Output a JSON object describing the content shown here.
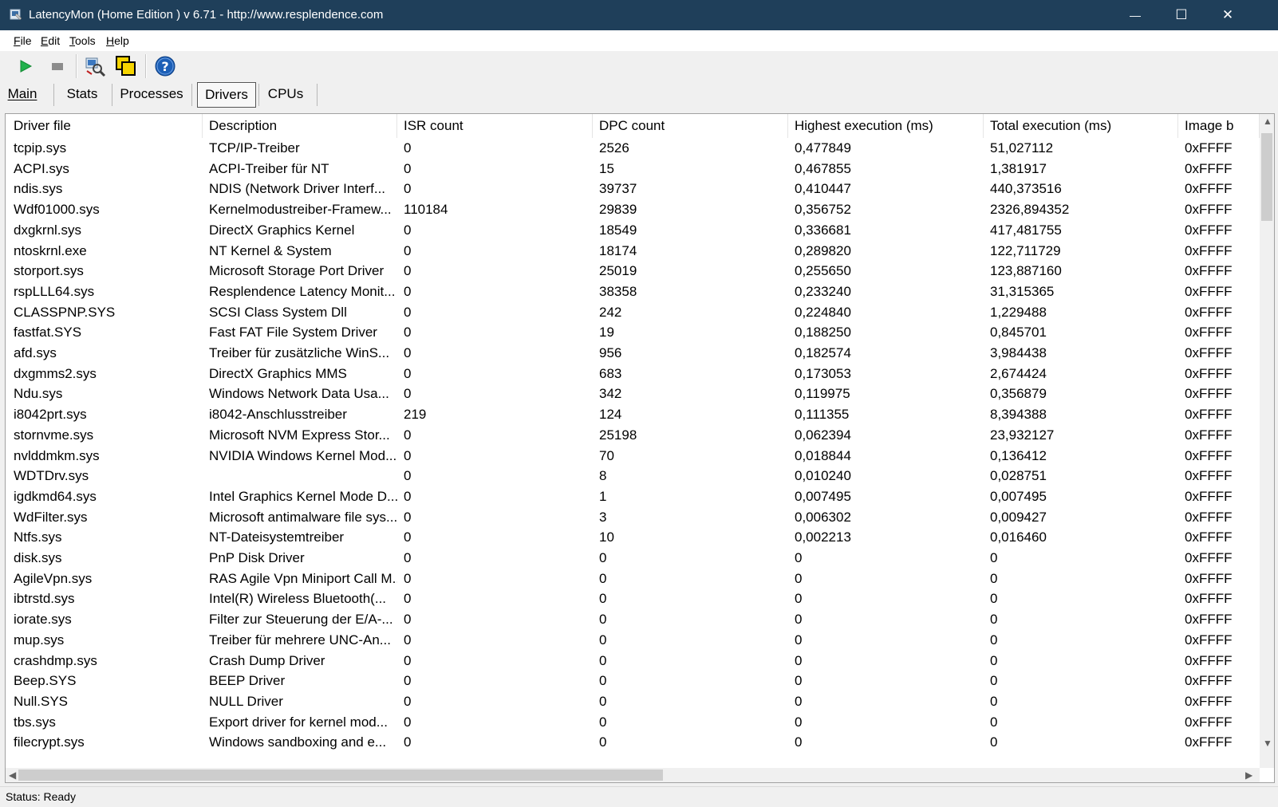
{
  "window": {
    "title": "LatencyMon  (Home Edition )  v 6.71 - http://www.resplendence.com",
    "minimize_glyph": "—",
    "maximize_glyph": "☐",
    "close_glyph": "✕"
  },
  "menu": {
    "file": {
      "u": "F",
      "rest": "ile"
    },
    "edit": {
      "u": "E",
      "rest": "dit"
    },
    "tools": {
      "u": "T",
      "rest": "ools"
    },
    "help": {
      "u": "H",
      "rest": "elp"
    }
  },
  "toolbar": {
    "icons": [
      "play-icon",
      "stop-icon",
      "analyze-icon",
      "windows-icon",
      "help-icon"
    ],
    "colors": {
      "play": "#22b14c",
      "stop": "#8c8c8c",
      "help": "#1c5fb7"
    }
  },
  "tabs": [
    {
      "label": "Main",
      "active": false
    },
    {
      "label": "Stats",
      "active": false
    },
    {
      "label": "Processes",
      "active": false
    },
    {
      "label": "Drivers",
      "active": true
    },
    {
      "label": "CPUs",
      "active": false
    }
  ],
  "table": {
    "columns": [
      "Driver file",
      "Description",
      "ISR count",
      "DPC count",
      "Highest execution (ms)",
      "Total execution (ms)",
      "Image b"
    ],
    "rows": [
      [
        "tcpip.sys",
        "TCP/IP-Treiber",
        "0",
        "2526",
        "0,477849",
        "51,027112",
        "0xFFFF"
      ],
      [
        "ACPI.sys",
        "ACPI-Treiber für NT",
        "0",
        "15",
        "0,467855",
        "1,381917",
        "0xFFFF"
      ],
      [
        "ndis.sys",
        "NDIS (Network Driver Interf...",
        "0",
        "39737",
        "0,410447",
        "440,373516",
        "0xFFFF"
      ],
      [
        "Wdf01000.sys",
        "Kernelmodustreiber-Framew...",
        "110184",
        "29839",
        "0,356752",
        "2326,894352",
        "0xFFFF"
      ],
      [
        "dxgkrnl.sys",
        "DirectX Graphics Kernel",
        "0",
        "18549",
        "0,336681",
        "417,481755",
        "0xFFFF"
      ],
      [
        "ntoskrnl.exe",
        "NT Kernel & System",
        "0",
        "18174",
        "0,289820",
        "122,711729",
        "0xFFFF"
      ],
      [
        "storport.sys",
        "Microsoft Storage Port Driver",
        "0",
        "25019",
        "0,255650",
        "123,887160",
        "0xFFFF"
      ],
      [
        "rspLLL64.sys",
        "Resplendence Latency Monit...",
        "0",
        "38358",
        "0,233240",
        "31,315365",
        "0xFFFF"
      ],
      [
        "CLASSPNP.SYS",
        "SCSI Class System Dll",
        "0",
        "242",
        "0,224840",
        "1,229488",
        "0xFFFF"
      ],
      [
        "fastfat.SYS",
        "Fast FAT File System Driver",
        "0",
        "19",
        "0,188250",
        "0,845701",
        "0xFFFF"
      ],
      [
        "afd.sys",
        "Treiber für zusätzliche WinS...",
        "0",
        "956",
        "0,182574",
        "3,984438",
        "0xFFFF"
      ],
      [
        "dxgmms2.sys",
        "DirectX Graphics MMS",
        "0",
        "683",
        "0,173053",
        "2,674424",
        "0xFFFF"
      ],
      [
        "Ndu.sys",
        "Windows Network Data Usa...",
        "0",
        "342",
        "0,119975",
        "0,356879",
        "0xFFFF"
      ],
      [
        "i8042prt.sys",
        "i8042-Anschlusstreiber",
        "219",
        "124",
        "0,111355",
        "8,394388",
        "0xFFFF"
      ],
      [
        "stornvme.sys",
        "Microsoft NVM Express Stor...",
        "0",
        "25198",
        "0,062394",
        "23,932127",
        "0xFFFF"
      ],
      [
        "nvlddmkm.sys",
        "NVIDIA Windows Kernel Mod...",
        "0",
        "70",
        "0,018844",
        "0,136412",
        "0xFFFF"
      ],
      [
        "WDTDrv.sys",
        "",
        "0",
        "8",
        "0,010240",
        "0,028751",
        "0xFFFF"
      ],
      [
        "igdkmd64.sys",
        "Intel Graphics Kernel Mode D...",
        "0",
        "1",
        "0,007495",
        "0,007495",
        "0xFFFF"
      ],
      [
        "WdFilter.sys",
        "Microsoft antimalware file sys...",
        "0",
        "3",
        "0,006302",
        "0,009427",
        "0xFFFF"
      ],
      [
        "Ntfs.sys",
        "NT-Dateisystemtreiber",
        "0",
        "10",
        "0,002213",
        "0,016460",
        "0xFFFF"
      ],
      [
        "disk.sys",
        "PnP Disk Driver",
        "0",
        "0",
        "0",
        "0",
        "0xFFFF"
      ],
      [
        "AgileVpn.sys",
        "RAS Agile Vpn Miniport Call M...",
        "0",
        "0",
        "0",
        "0",
        "0xFFFF"
      ],
      [
        "ibtrstd.sys",
        "Intel(R) Wireless Bluetooth(...",
        "0",
        "0",
        "0",
        "0",
        "0xFFFF"
      ],
      [
        "iorate.sys",
        "Filter zur Steuerung der E/A-...",
        "0",
        "0",
        "0",
        "0",
        "0xFFFF"
      ],
      [
        "mup.sys",
        "Treiber für mehrere UNC-An...",
        "0",
        "0",
        "0",
        "0",
        "0xFFFF"
      ],
      [
        "crashdmp.sys",
        "Crash Dump Driver",
        "0",
        "0",
        "0",
        "0",
        "0xFFFF"
      ],
      [
        "Beep.SYS",
        "BEEP Driver",
        "0",
        "0",
        "0",
        "0",
        "0xFFFF"
      ],
      [
        "Null.SYS",
        "NULL Driver",
        "0",
        "0",
        "0",
        "0",
        "0xFFFF"
      ],
      [
        "tbs.sys",
        "Export driver for kernel mod...",
        "0",
        "0",
        "0",
        "0",
        "0xFFFF"
      ],
      [
        "filecrypt.sys",
        "Windows sandboxing and e...",
        "0",
        "0",
        "0",
        "0",
        "0xFFFF"
      ]
    ]
  },
  "status": {
    "text": "Status: Ready"
  },
  "colors": {
    "titlebar": "#1f3f5a",
    "window_bg": "#f0f0f0",
    "list_bg": "#ffffff"
  }
}
